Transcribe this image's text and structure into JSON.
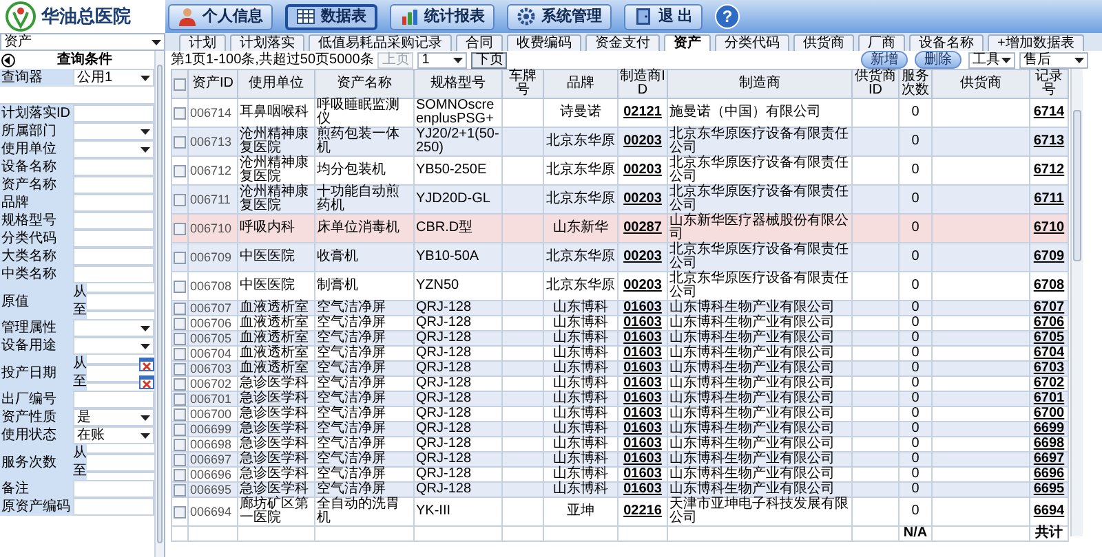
{
  "header": {
    "hospital_name": "华油总医院",
    "nav": [
      {
        "label": "个人信息",
        "selected": false
      },
      {
        "label": "数据表",
        "selected": true
      },
      {
        "label": "统计报表",
        "selected": false
      },
      {
        "label": "系统管理",
        "selected": false
      },
      {
        "label": "退 出",
        "selected": false
      }
    ],
    "help": "?"
  },
  "table_select": {
    "value": "资产"
  },
  "tabs": [
    {
      "label": "计划",
      "selected": false
    },
    {
      "label": "计划落实",
      "selected": false
    },
    {
      "label": "低值易耗品采购记录",
      "selected": false
    },
    {
      "label": "合同",
      "selected": false
    },
    {
      "label": "收费编码",
      "selected": false
    },
    {
      "label": "资金支付",
      "selected": false
    },
    {
      "label": "资产",
      "selected": true
    },
    {
      "label": "分类代码",
      "selected": false
    },
    {
      "label": "供货商",
      "selected": false
    },
    {
      "label": "厂商",
      "selected": false
    },
    {
      "label": "设备名称",
      "selected": false
    },
    {
      "label": "+增加数据表",
      "selected": false
    }
  ],
  "filter_panel": {
    "title": "查询条件",
    "selector": {
      "label": "查询器",
      "value": "公用1"
    },
    "fields": [
      {
        "label": "计划落实ID",
        "kind": "text"
      },
      {
        "label": "所属部门",
        "kind": "select"
      },
      {
        "label": "使用单位",
        "kind": "select"
      },
      {
        "label": "设备名称",
        "kind": "text"
      },
      {
        "label": "资产名称",
        "kind": "text"
      },
      {
        "label": "品牌",
        "kind": "text"
      },
      {
        "label": "规格型号",
        "kind": "text"
      },
      {
        "label": "分类代码",
        "kind": "text"
      },
      {
        "label": "大类名称",
        "kind": "text"
      },
      {
        "label": "中类名称",
        "kind": "text"
      },
      {
        "label": "原值",
        "kind": "range",
        "from_label": "从",
        "to_label": "至"
      },
      {
        "label": "管理属性",
        "kind": "select"
      },
      {
        "label": "设备用途",
        "kind": "select"
      },
      {
        "label": "投产日期",
        "kind": "date_range",
        "from_label": "从",
        "to_label": "至"
      },
      {
        "label": "出厂编号",
        "kind": "text"
      },
      {
        "label": "资产性质",
        "kind": "select",
        "value": "是"
      },
      {
        "label": "使用状态",
        "kind": "select",
        "value": "在账"
      },
      {
        "label": "服务次数",
        "kind": "range",
        "from_label": "从",
        "to_label": "至"
      },
      {
        "label": "备注",
        "kind": "text"
      },
      {
        "label": "原资产编码",
        "kind": "text"
      }
    ]
  },
  "pagination": {
    "summary": "第1页1-100条,共超过50页5000条",
    "prev": "上页",
    "prev_disabled": true,
    "page": "1",
    "next": "下页"
  },
  "actions": {
    "add": "新增",
    "delete": "删除",
    "tools": "工具",
    "after_sales": "售后"
  },
  "table": {
    "header_checked": false,
    "columns": [
      "资产ID",
      "使用单位",
      "资产名称",
      "规格型号",
      "车牌号",
      "品牌",
      "制造商ID",
      "制造商",
      "供货商ID",
      "服务次数",
      "供货商",
      "记录号"
    ],
    "rows": [
      {
        "checked": false,
        "highlighted": false,
        "id": "006714",
        "unit": "耳鼻咽喉科",
        "name": "呼吸睡眠监测仪",
        "spec": "SOMNOscreenplusPSG+",
        "brand": "诗曼诺",
        "mfr_id": "02121",
        "mfr": "施曼诺（中国）有限公司",
        "service_count": "0",
        "record": "6714"
      },
      {
        "checked": false,
        "highlighted": false,
        "id": "006713",
        "unit": "沧州精神康复医院",
        "name": "煎药包装一体机",
        "spec": "YJ20/2+1(50-250)",
        "brand": "北京东华原",
        "mfr_id": "00203",
        "mfr": "北京东华原医疗设备有限责任公司",
        "service_count": "0",
        "record": "6713"
      },
      {
        "checked": false,
        "highlighted": false,
        "id": "006712",
        "unit": "沧州精神康复医院",
        "name": "均分包装机",
        "spec": "YB50-250E",
        "brand": "北京东华原",
        "mfr_id": "00203",
        "mfr": "北京东华原医疗设备有限责任公司",
        "service_count": "0",
        "record": "6712"
      },
      {
        "checked": false,
        "highlighted": false,
        "id": "006711",
        "unit": "沧州精神康复医院",
        "name": "十功能自动煎药机",
        "spec": "YJD20D-GL",
        "brand": "北京东华原",
        "mfr_id": "00203",
        "mfr": "北京东华原医疗设备有限责任公司",
        "service_count": "0",
        "record": "6711"
      },
      {
        "checked": false,
        "highlighted": true,
        "id": "006710",
        "unit": "呼吸内科",
        "name": "床单位消毒机",
        "spec": "CBR.D型",
        "brand": "山东新华",
        "mfr_id": "00287",
        "mfr": "山东新华医疗器械股份有限公司",
        "service_count": "0",
        "record": "6710"
      },
      {
        "checked": false,
        "highlighted": false,
        "id": "006709",
        "unit": "中医医院",
        "name": "收膏机",
        "spec": "YB10-50A",
        "brand": "北京东华原",
        "mfr_id": "00203",
        "mfr": "北京东华原医疗设备有限责任公司",
        "service_count": "0",
        "record": "6709"
      },
      {
        "checked": false,
        "highlighted": false,
        "id": "006708",
        "unit": "中医医院",
        "name": "制膏机",
        "spec": "YZN50",
        "brand": "北京东华原",
        "mfr_id": "00203",
        "mfr": "北京东华原医疗设备有限责任公司",
        "service_count": "0",
        "record": "6708"
      },
      {
        "checked": false,
        "highlighted": false,
        "id": "006707",
        "unit": "血液透析室",
        "name": "空气洁净屏",
        "spec": "QRJ-128",
        "brand": "山东博科",
        "mfr_id": "01603",
        "mfr": "山东博科生物产业有限公司",
        "service_count": "0",
        "record": "6707"
      },
      {
        "checked": false,
        "highlighted": false,
        "id": "006706",
        "unit": "血液透析室",
        "name": "空气洁净屏",
        "spec": "QRJ-128",
        "brand": "山东博科",
        "mfr_id": "01603",
        "mfr": "山东博科生物产业有限公司",
        "service_count": "0",
        "record": "6706"
      },
      {
        "checked": false,
        "highlighted": false,
        "id": "006705",
        "unit": "血液透析室",
        "name": "空气洁净屏",
        "spec": "QRJ-128",
        "brand": "山东博科",
        "mfr_id": "01603",
        "mfr": "山东博科生物产业有限公司",
        "service_count": "0",
        "record": "6705"
      },
      {
        "checked": false,
        "highlighted": false,
        "id": "006704",
        "unit": "血液透析室",
        "name": "空气洁净屏",
        "spec": "QRJ-128",
        "brand": "山东博科",
        "mfr_id": "01603",
        "mfr": "山东博科生物产业有限公司",
        "service_count": "0",
        "record": "6704"
      },
      {
        "checked": false,
        "highlighted": false,
        "id": "006703",
        "unit": "血液透析室",
        "name": "空气洁净屏",
        "spec": "QRJ-128",
        "brand": "山东博科",
        "mfr_id": "01603",
        "mfr": "山东博科生物产业有限公司",
        "service_count": "0",
        "record": "6703"
      },
      {
        "checked": false,
        "highlighted": false,
        "id": "006702",
        "unit": "急诊医学科",
        "name": "空气洁净屏",
        "spec": "QRJ-128",
        "brand": "山东博科",
        "mfr_id": "01603",
        "mfr": "山东博科生物产业有限公司",
        "service_count": "0",
        "record": "6702"
      },
      {
        "checked": false,
        "highlighted": false,
        "id": "006701",
        "unit": "急诊医学科",
        "name": "空气洁净屏",
        "spec": "QRJ-128",
        "brand": "山东博科",
        "mfr_id": "01603",
        "mfr": "山东博科生物产业有限公司",
        "service_count": "0",
        "record": "6701"
      },
      {
        "checked": false,
        "highlighted": false,
        "id": "006700",
        "unit": "急诊医学科",
        "name": "空气洁净屏",
        "spec": "QRJ-128",
        "brand": "山东博科",
        "mfr_id": "01603",
        "mfr": "山东博科生物产业有限公司",
        "service_count": "0",
        "record": "6700"
      },
      {
        "checked": false,
        "highlighted": false,
        "id": "006699",
        "unit": "急诊医学科",
        "name": "空气洁净屏",
        "spec": "QRJ-128",
        "brand": "山东博科",
        "mfr_id": "01603",
        "mfr": "山东博科生物产业有限公司",
        "service_count": "0",
        "record": "6699"
      },
      {
        "checked": false,
        "highlighted": false,
        "id": "006698",
        "unit": "急诊医学科",
        "name": "空气洁净屏",
        "spec": "QRJ-128",
        "brand": "山东博科",
        "mfr_id": "01603",
        "mfr": "山东博科生物产业有限公司",
        "service_count": "0",
        "record": "6698"
      },
      {
        "checked": false,
        "highlighted": false,
        "id": "006697",
        "unit": "急诊医学科",
        "name": "空气洁净屏",
        "spec": "QRJ-128",
        "brand": "山东博科",
        "mfr_id": "01603",
        "mfr": "山东博科生物产业有限公司",
        "service_count": "0",
        "record": "6697"
      },
      {
        "checked": false,
        "highlighted": false,
        "id": "006696",
        "unit": "急诊医学科",
        "name": "空气洁净屏",
        "spec": "QRJ-128",
        "brand": "山东博科",
        "mfr_id": "01603",
        "mfr": "山东博科生物产业有限公司",
        "service_count": "0",
        "record": "6696"
      },
      {
        "checked": false,
        "highlighted": false,
        "id": "006695",
        "unit": "急诊医学科",
        "name": "空气洁净屏",
        "spec": "QRJ-128",
        "brand": "山东博科",
        "mfr_id": "01603",
        "mfr": "山东博科生物产业有限公司",
        "service_count": "0",
        "record": "6695"
      },
      {
        "checked": false,
        "highlighted": false,
        "id": "006694",
        "unit": "廊坊矿区第一医院",
        "name": "全自动的洗胃机",
        "spec": "YK-III",
        "brand": "亚坤",
        "mfr_id": "02216",
        "mfr": "天津市亚坤电子科技发展有限公司",
        "service_count": "0",
        "record": "6694"
      }
    ],
    "footer": {
      "service_count": "N/A",
      "record": "共计"
    }
  }
}
